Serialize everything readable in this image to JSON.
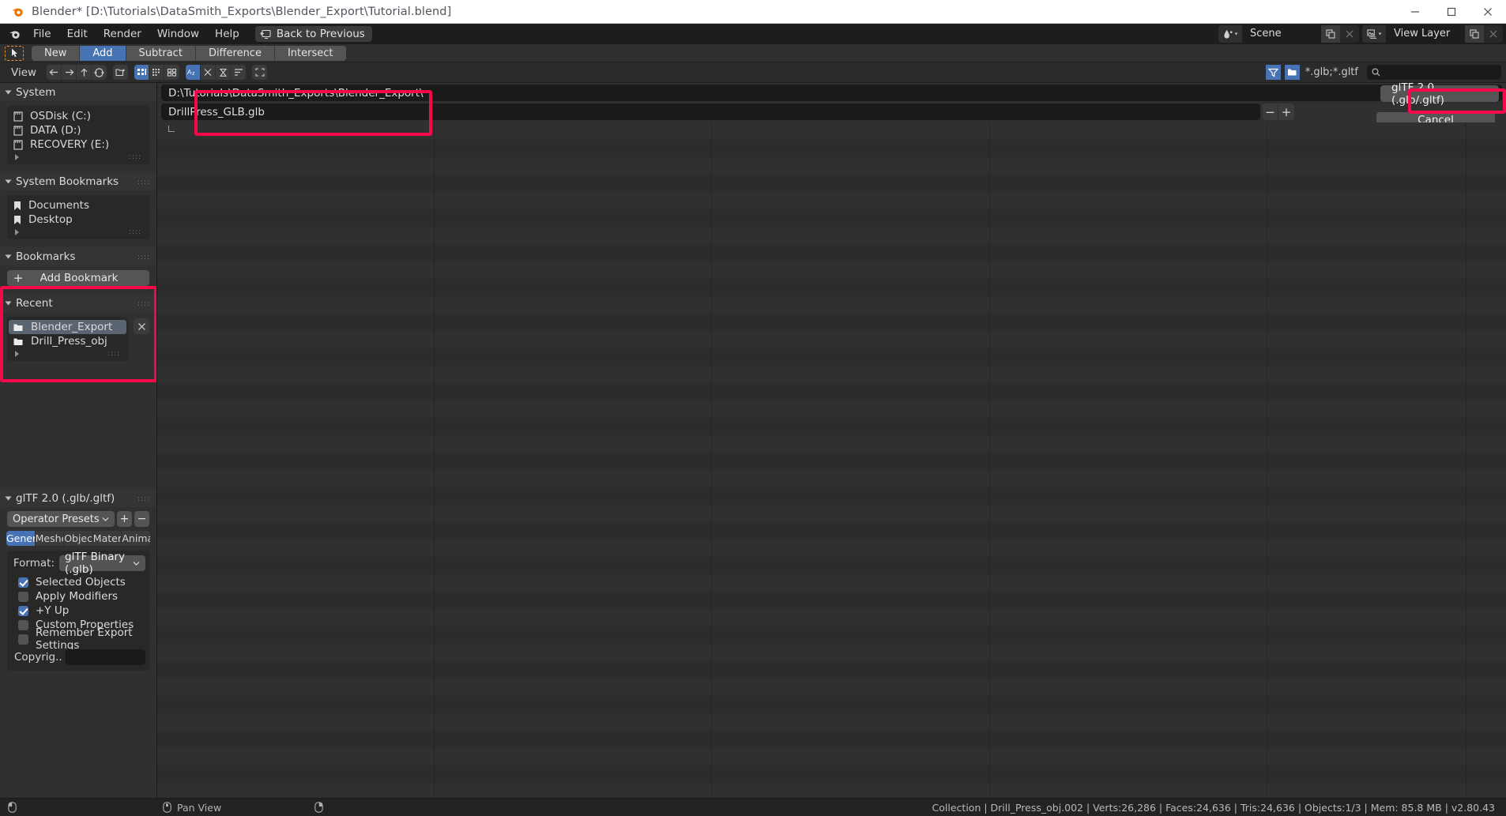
{
  "window": {
    "title": "Blender* [D:\\Tutorials\\DataSmith_Exports\\Blender_Export\\Tutorial.blend]",
    "minimize": "—",
    "maximize": "☐",
    "close": "✕"
  },
  "menubar": {
    "items": [
      "File",
      "Edit",
      "Render",
      "Window",
      "Help"
    ],
    "back_to_previous": "Back to Previous",
    "scene_name": "Scene",
    "view_layer_name": "View Layer"
  },
  "toolrow": {
    "modes": [
      {
        "label": "New",
        "active": false
      },
      {
        "label": "Add",
        "active": true
      },
      {
        "label": "Subtract",
        "active": false
      },
      {
        "label": "Difference",
        "active": false
      },
      {
        "label": "Intersect",
        "active": false
      }
    ]
  },
  "filebrowser_header": {
    "view_menu": "View",
    "filter_extension": "*.glb;*.gltf",
    "search_placeholder": ""
  },
  "sidebar": {
    "system": {
      "title": "System",
      "items": [
        {
          "label": "OSDisk (C:)",
          "icon": "drive-icon"
        },
        {
          "label": "DATA (D:)",
          "icon": "drive-icon"
        },
        {
          "label": "RECOVERY (E:)",
          "icon": "drive-icon"
        }
      ]
    },
    "system_bookmarks": {
      "title": "System Bookmarks",
      "items": [
        {
          "label": "Documents",
          "icon": "bookmark-icon"
        },
        {
          "label": "Desktop",
          "icon": "bookmark-icon"
        }
      ]
    },
    "bookmarks": {
      "title": "Bookmarks",
      "add_label": "Add Bookmark"
    },
    "recent": {
      "title": "Recent",
      "items": [
        {
          "label": "Blender_Export",
          "icon": "folder-icon",
          "selected": true
        },
        {
          "label": "Drill_Press_obj",
          "icon": "folder-icon",
          "selected": false
        }
      ],
      "clear_label": "✕"
    },
    "export_options": {
      "title": "glTF 2.0 (.glb/.gltf)",
      "preset_label": "Operator Presets",
      "preset_add": "+",
      "preset_remove": "−",
      "tabs": [
        {
          "label": "General",
          "active": true
        },
        {
          "label": "Meshes",
          "active": false
        },
        {
          "label": "Objects",
          "active": false
        },
        {
          "label": "Materi..",
          "active": false
        },
        {
          "label": "Anima..",
          "active": false
        }
      ],
      "format_label": "Format:",
      "format_value": "glTF Binary (.glb)",
      "checkboxes": [
        {
          "label": "Selected Objects",
          "checked": true
        },
        {
          "label": "Apply Modifiers",
          "checked": false
        },
        {
          "label": "+Y Up",
          "checked": true
        },
        {
          "label": "Custom Properties",
          "checked": false
        },
        {
          "label": "Remember Export Settings",
          "checked": false
        }
      ],
      "copyright_label": "Copyrig..",
      "copyright_value": ""
    }
  },
  "main": {
    "directory_path": "D:\\Tutorials\\DataSmith_Exports\\Blender_Export\\",
    "file_name": "DrillPress_GLB.glb",
    "decrement": "−",
    "increment": "+",
    "export_label": "glTF 2.0 (.glb/.gltf)",
    "cancel_label": "Cancel"
  },
  "statusbar": {
    "pan_view": "Pan View",
    "info": "Collection | Drill_Press_obj.002 | Verts:26,286 | Faces:24,636 | Tris:24,636 | Objects:1/3 | Mem: 85.8 MB | v2.80.43"
  },
  "colors": {
    "accent_blue": "#4772b3",
    "highlight_red": "#f5094a",
    "orange": "#e8912a"
  }
}
